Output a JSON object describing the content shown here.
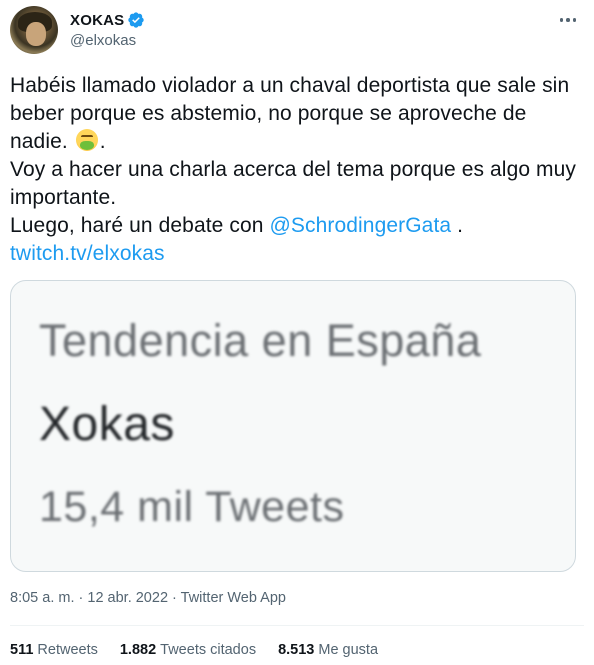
{
  "author": {
    "display_name": "XOKAS",
    "handle": "@elxokas",
    "verified": true
  },
  "tweet": {
    "lines": [
      "Habéis llamado violador a un chaval deportista que sale sin beber porque es abstemio, no porque se aprovechede nadie.",
      "Voy a hacer una charla acerca del tema porque es algo muy importante."
    ],
    "line1": "Habéis llamado violador a un chaval deportista que sale sin beber porque es abstemio, no porque se aprovechede nadie.",
    "line1_main": "Habéis llamado violador a un chaval deportista que sale sin beber porque es abstemio, no porque se aproveche de nadie.",
    "line1_after_emoji": ".",
    "emoji": "nauseated-face-emoji",
    "line2": "Voy a hacer una charla acerca del tema porque es algo muy importante.",
    "line3_prefix": "Luego, haré un debate con ",
    "mention": "@SchrodingerGata",
    "line3_suffix": " .",
    "link": "twitch.tv/elxokas"
  },
  "card": {
    "trend_label": "Tendencia en España",
    "topic": "Xokas",
    "count": "15,4 mil Tweets"
  },
  "meta": {
    "time": "8:05 a. m.",
    "separator": " · ",
    "date": "12 abr. 2022",
    "source": "Twitter Web App"
  },
  "stats": {
    "retweets_count": "511",
    "retweets_label": "Retweets",
    "quotes_count": "1.882",
    "quotes_label": "Tweets citados",
    "likes_count": "8.513",
    "likes_label": "Me gusta"
  },
  "colors": {
    "accent": "#1d9bf0",
    "secondary_text": "#536471",
    "border": "#cfd9de"
  },
  "icons": [
    "verified-badge-icon",
    "more-options-icon"
  ]
}
